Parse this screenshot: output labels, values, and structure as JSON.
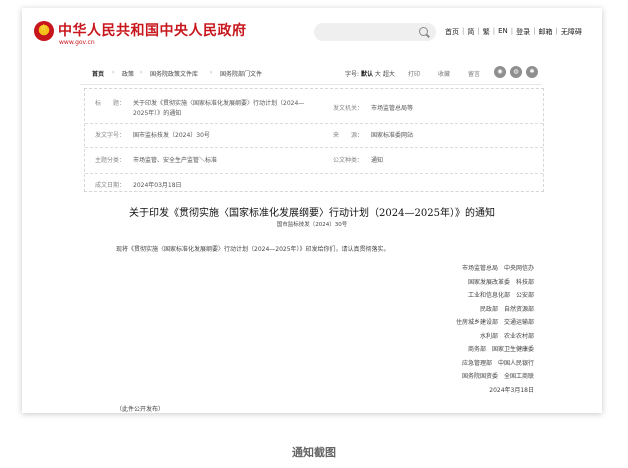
{
  "header": {
    "site_title": "中华人民共和国中央人民政府",
    "site_url": "www.gov.cn",
    "nav": [
      "首页",
      "简",
      "繁",
      "EN",
      "登录",
      "邮箱",
      "无障碍"
    ]
  },
  "breadcrumb": {
    "items": [
      "首页",
      "政策",
      "国务院政策文件库",
      "国务院部门文件"
    ],
    "font_size_label": "字号:",
    "font_sizes": [
      "默认",
      "大",
      "超大"
    ],
    "print_label": "打印",
    "favorite_label": "收藏",
    "hide_label": "留言"
  },
  "info": {
    "title_label": "标　　题：",
    "title_value_1": "关于印发《贯彻实施〈国家标准化发展纲要〉行动计划（2024—",
    "title_value_2": "2025年）》的通知",
    "issuer_label": "发文机关：",
    "issuer_value": "市场监管总局等",
    "doc_no_label": "发文字号：",
    "doc_no_value": "国市监标技发〔2024〕30号",
    "source_label": "来　　源：",
    "source_value": "国家标准委网站",
    "topic_label": "主题分类：",
    "topic_value": "市场监管、安全生产监管＼标准",
    "doc_type_label": "公文种类：",
    "doc_type_value": "通知",
    "date_label": "成文日期：",
    "date_value": "2024年03月18日"
  },
  "document": {
    "title": "关于印发《贯彻实施〈国家标准化发展纲要〉行动计划（2024—2025年）》的通知",
    "number": "国市监标技发〔2024〕30号",
    "body": "现将《贯彻实施〈国家标准化发展纲要〉行动计划（2024—2025年）》印发给你们，请认真贯彻落实。",
    "signers": [
      "市场监管总局　中央网信办",
      "国家发展改革委　科技部",
      "工业和信息化部　公安部",
      "民政部　自然资源部",
      "住房城乡建设部　交通运输部",
      "水利部　农业农村部",
      "商务部　国家卫生健康委",
      "应急管理部　中国人民银行",
      "国务院国资委　全国工商联",
      "2024年3月18日"
    ],
    "footer_note": "（此件公开发布）"
  },
  "caption": "通知截图"
}
